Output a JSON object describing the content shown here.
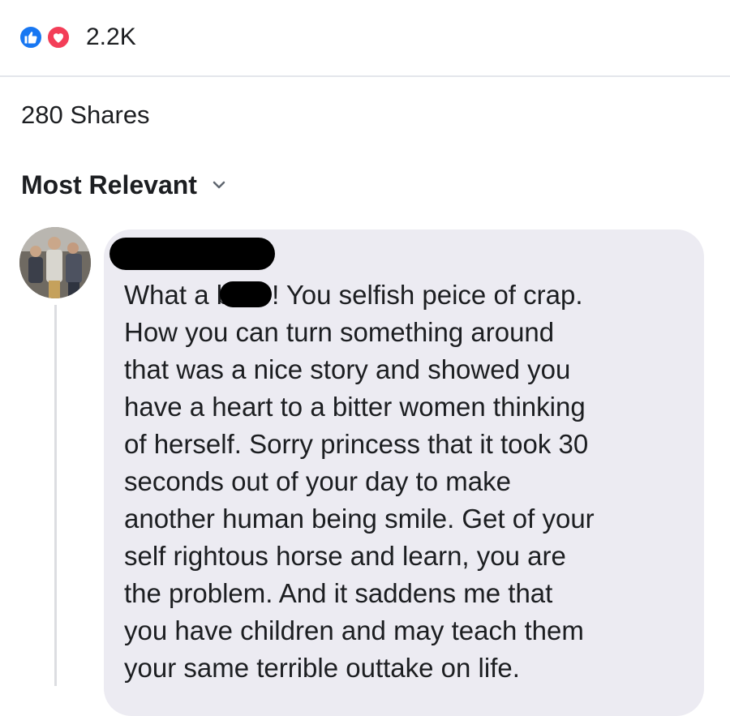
{
  "reactions": {
    "icons": [
      "like-icon",
      "love-icon"
    ],
    "count": "2.2K",
    "colors": {
      "like": "#1877f2",
      "love": "#f33e58"
    }
  },
  "shares": {
    "label": "280 Shares"
  },
  "sort": {
    "label": "Most Relevant",
    "icon": "chevron-down-icon"
  },
  "comment": {
    "avatar_icon": "avatar",
    "author_redacted": true,
    "line_1_prefix": "What a b",
    "line_1_suffix": "! You selfish peice of crap.",
    "lines": [
      "How you can turn something around",
      "that was a nice story and showed you",
      "have a heart to a bitter women thinking",
      "of herself. Sorry princess that it took 30",
      "seconds out of your day to make",
      "another human being smile. Get of your",
      "self rightous horse and learn, you are",
      "the problem. And it saddens me that",
      "you have children and may teach them",
      "your same terrible outtake on life."
    ],
    "bubble_color": "#ecebf2"
  }
}
